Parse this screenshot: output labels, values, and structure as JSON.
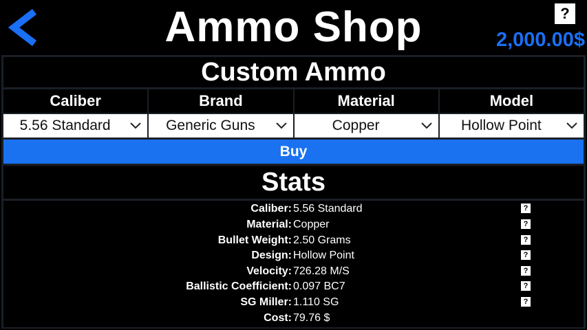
{
  "header": {
    "title": "Ammo Shop",
    "money": "2,000.00$",
    "help_label": "?",
    "back_icon": "chevron-left-icon",
    "accent_color": "#1a6ff5"
  },
  "custom": {
    "title": "Custom Ammo",
    "columns": [
      {
        "label": "Caliber",
        "value": "5.56 Standard"
      },
      {
        "label": "Brand",
        "value": "Generic Guns"
      },
      {
        "label": "Material",
        "value": "Copper"
      },
      {
        "label": "Model",
        "value": "Hollow Point"
      }
    ],
    "buy_label": "Buy"
  },
  "stats": {
    "title": "Stats",
    "rows": [
      {
        "label": "Caliber:",
        "value": "5.56 Standard",
        "help": "?"
      },
      {
        "label": "Material:",
        "value": "Copper",
        "help": "?"
      },
      {
        "label": "Bullet Weight:",
        "value": "2.50 Grams",
        "help": "?"
      },
      {
        "label": "Design:",
        "value": "Hollow Point",
        "help": "?"
      },
      {
        "label": "Velocity:",
        "value": "726.28 M/S",
        "help": "?"
      },
      {
        "label": "Ballistic Coefficient:",
        "value": "0.097 BC7",
        "help": "?"
      },
      {
        "label": "SG Miller:",
        "value": "1.110 SG",
        "help": "?"
      },
      {
        "label": "Cost:",
        "value": "79.76 $",
        "help": null
      }
    ]
  }
}
